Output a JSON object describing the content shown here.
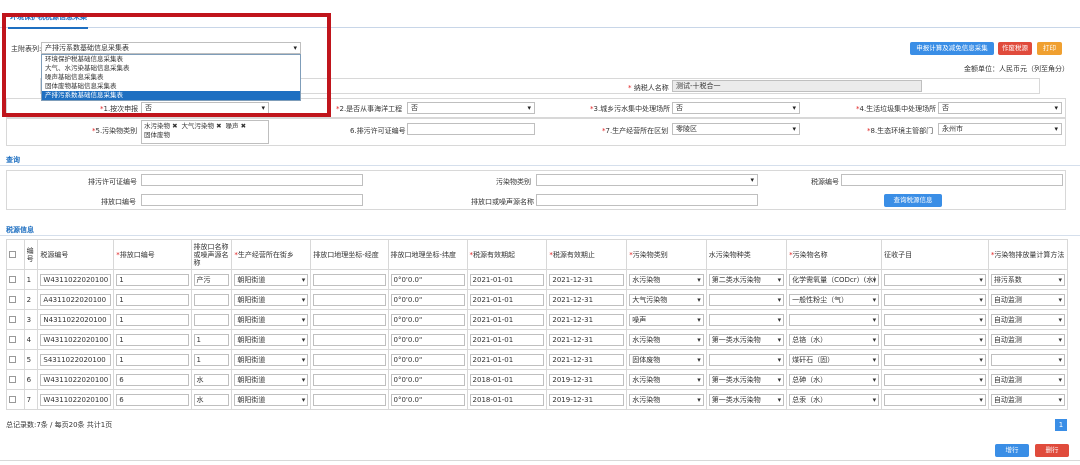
{
  "tab": {
    "label": "环境保护税税源信息采集"
  },
  "form_type": {
    "label": "主附表列:",
    "value": "产排污系数基础信息采集表",
    "options": [
      "环境保护税基础信息采集表",
      "大气、水污染基础信息采集表",
      "噪声基础信息采集表",
      "固体废物基础信息采集表",
      "产排污系数基础信息采集表"
    ],
    "selected_index": 4
  },
  "toolbar": {
    "calc_label": "申报计算及减免信息采集",
    "void_label": "作废税源",
    "print_label": "打印"
  },
  "unit": "金额单位：人民币元（列至角分）",
  "taxpayer": {
    "name_label": "纳税人名称",
    "name_value": "测试-十税合一"
  },
  "row1": {
    "f1_label": "1.按次申报",
    "f1_value": "否",
    "f2_label": "2.是否从事海洋工程",
    "f2_value": "否",
    "f3_label": "3.城乡污水集中处理场所",
    "f3_value": "否",
    "f4_label": "4.生活垃圾集中处理场所",
    "f4_value": "否"
  },
  "row2": {
    "f5_label": "5.污染物类别",
    "f5_chips": [
      "水污染物",
      "大气污染物",
      "噪声",
      "固体废物"
    ],
    "f6_label": "6.排污许可证编号",
    "f6_value": "",
    "f7_label": "7.生产经营所在区划",
    "f7_value": "零陵区",
    "f8_label": "8.生态环境主管部门",
    "f8_value": "永州市"
  },
  "query": {
    "title": "查询",
    "permit_label": "排污许可证编号",
    "category_label": "污染物类别",
    "source_no_label": "税源编号",
    "outlet_label": "排放口编号",
    "outlet_name_label": "排放口或噪声源名称",
    "button": "查询税源信息"
  },
  "tax_source": {
    "title": "税源信息",
    "headers": [
      "编号",
      "税源编号",
      "排放口编号",
      "排放口名称或噪声源名称",
      "生产经营所在街乡",
      "排放口地理坐标-经度",
      "排放口地理坐标-纬度",
      "税源有效期起",
      "税源有效期止",
      "污染物类别",
      "水污染物种类",
      "污染物名称",
      "征收子目",
      "污染物排放量计算方法"
    ],
    "required": [
      false,
      false,
      true,
      false,
      true,
      false,
      false,
      true,
      true,
      true,
      false,
      true,
      false,
      true
    ],
    "rows": [
      {
        "no": "1",
        "id": "W4311022020100",
        "outlet": "1",
        "name": "产污",
        "street": "朝阳街道",
        "lng": "",
        "lat": "0°0'0.0\"",
        "start": "2021-01-01",
        "end": "2021-12-31",
        "cat": "水污染物",
        "water": "第二类水污染物",
        "pol": "化学需氧量（CODcr）(水)",
        "sub": "",
        "method": "排污系数"
      },
      {
        "no": "2",
        "id": "A4311022020100",
        "outlet": "1",
        "name": "",
        "street": "朝阳街道",
        "lng": "",
        "lat": "0°0'0.0\"",
        "start": "2021-01-01",
        "end": "2021-12-31",
        "cat": "大气污染物",
        "water": "",
        "pol": "一般性粉尘（气）",
        "sub": "",
        "method": "自动监测"
      },
      {
        "no": "3",
        "id": "N4311022020100",
        "outlet": "1",
        "name": "",
        "street": "朝阳街道",
        "lng": "",
        "lat": "0°0'0.0\"",
        "start": "2021-01-01",
        "end": "2021-12-31",
        "cat": "噪声",
        "water": "",
        "pol": "",
        "sub": "",
        "method": "自动监测"
      },
      {
        "no": "4",
        "id": "W4311022020100",
        "outlet": "1",
        "name": "1",
        "street": "朝阳街道",
        "lng": "",
        "lat": "0°0'0.0\"",
        "start": "2021-01-01",
        "end": "2021-12-31",
        "cat": "水污染物",
        "water": "第一类水污染物",
        "pol": "总铬（水）",
        "sub": "",
        "method": "自动监测"
      },
      {
        "no": "5",
        "id": "S4311022020100",
        "outlet": "1",
        "name": "1",
        "street": "朝阳街道",
        "lng": "",
        "lat": "0°0'0.0\"",
        "start": "2021-01-01",
        "end": "2021-12-31",
        "cat": "固体废物",
        "water": "",
        "pol": "煤矸石（固）",
        "sub": "",
        "method": ""
      },
      {
        "no": "6",
        "id": "W4311022020100",
        "outlet": "6",
        "name": "水",
        "street": "朝阳街道",
        "lng": "",
        "lat": "0°0'0.0\"",
        "start": "2018-01-01",
        "end": "2019-12-31",
        "cat": "水污染物",
        "water": "第一类水污染物",
        "pol": "总砷（水）",
        "sub": "",
        "method": "自动监测"
      },
      {
        "no": "7",
        "id": "W4311022020100",
        "outlet": "6",
        "name": "水",
        "street": "朝阳街道",
        "lng": "",
        "lat": "0°0'0.0\"",
        "start": "2018-01-01",
        "end": "2019-12-31",
        "cat": "水污染物",
        "water": "第一类水污染物",
        "pol": "总汞（水）",
        "sub": "",
        "method": "自动监测"
      }
    ]
  },
  "pager": {
    "summary": "总记录数:7条 / 每页20条 共计1页",
    "page": "1"
  },
  "bottom": {
    "add_label": "增行",
    "del_label": "删行"
  }
}
